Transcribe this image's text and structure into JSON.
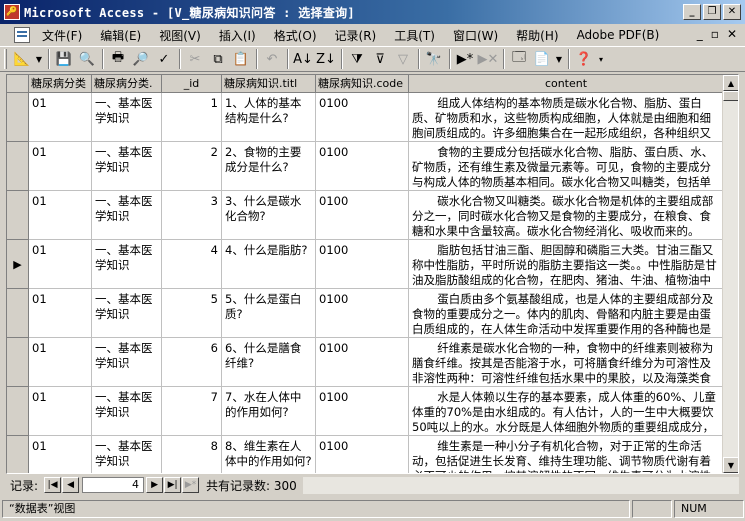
{
  "window": {
    "title": "Microsoft Access - [V_糖尿病知识问答 : 选择查询]",
    "min_icon": "minimize-icon",
    "max_icon": "restore-icon",
    "close_icon": "close-icon"
  },
  "menu": {
    "items": [
      "文件(F)",
      "编辑(E)",
      "视图(V)",
      "插入(I)",
      "格式(O)",
      "记录(R)",
      "工具(T)",
      "窗口(W)",
      "帮助(H)",
      "Adobe PDF(B)"
    ],
    "doc_controls": [
      "_",
      "▫",
      "✕"
    ]
  },
  "toolbar": {
    "icons": [
      "design-view-icon",
      "dropdown-arrow-icon",
      "save-icon",
      "file-search-icon",
      "print-icon",
      "print-preview-icon",
      "spelling-icon",
      "cut-icon",
      "copy-icon",
      "paste-icon",
      "undo-icon",
      "sort-ascending-icon",
      "sort-descending-icon",
      "filter-by-selection-icon",
      "filter-by-form-icon",
      "apply-filter-icon",
      "find-icon",
      "new-record-icon",
      "delete-record-icon",
      "database-window-icon",
      "new-object-icon",
      "help-icon"
    ]
  },
  "grid": {
    "columns": [
      {
        "key": "c1",
        "header": "糖尿病分类"
      },
      {
        "key": "c2",
        "header": "糖尿病分类."
      },
      {
        "key": "c3",
        "header": "_id"
      },
      {
        "key": "c4",
        "header": "糖尿病知识.titl"
      },
      {
        "key": "c5",
        "header": "糖尿病知识.code"
      },
      {
        "key": "c6",
        "header": "content"
      }
    ],
    "current_row_marker": "▶",
    "rows": [
      {
        "c1": "01",
        "c2": "一、基本医学知识",
        "c3": "1",
        "c4": "1、人体的基本结构是什么?",
        "c5": "0100",
        "c6": "组成人体结构的基本物质是碳水化合物、脂肪、蛋白质、矿物质和水，这些物质构成细胞，人体就是由细胞和细胞间质组成的。许多细胞集合在一起形成组织，各种组织又构成了器官。"
      },
      {
        "c1": "01",
        "c2": "一、基本医学知识",
        "c3": "2",
        "c4": "2、食物的主要成分是什么?",
        "c5": "0100",
        "c6": "食物的主要成分包括碳水化合物、脂肪、蛋白质、水、矿物质，还有维生素及微量元素等。可见，食物的主要成分与构成人体的物质基本相同。碳水化合物又叫糖类，包括单糖、双糖和多糖。"
      },
      {
        "c1": "01",
        "c2": "一、基本医学知识",
        "c3": "3",
        "c4": "3、什么是碳水化合物?",
        "c5": "0100",
        "c6": "碳水化合物又叫糖类。碳水化合物是机体的主要组成部分之一，同时碳水化合物又是食物的主要成分，在粮食、食糖和水果中含量较高。碳水化合物经消化、吸收而来的。"
      },
      {
        "c1": "01",
        "c2": "一、基本医学知识",
        "c3": "4",
        "c4": "4、什么是脂肪?",
        "c5": "0100",
        "c6": "脂肪包括甘油三酯、胆固醇和磷脂三大类。甘油三酯又称中性脂肪，平时所说的脂肪主要指这一类。。中性脂肪是甘油及脂肪酸组成的化合物，在肥肉、猪油、牛油、植物油中含量丰富。"
      },
      {
        "c1": "01",
        "c2": "一、基本医学知识",
        "c3": "5",
        "c4": "5、什么是蛋白质?",
        "c5": "0100",
        "c6": "蛋白质由多个氨基酸组成，也是人体的主要组成部分及食物的重要成分之一。体内的肌肉、骨骼和内脏主要是由蛋白质组成的，在人体生命活动中发挥重要作用的各种酶也是蛋白质。"
      },
      {
        "c1": "01",
        "c2": "一、基本医学知识",
        "c3": "6",
        "c4": "6、什么是膳食纤维?",
        "c5": "0100",
        "c6": "纤维素是碳水化合物的一种，食物中的纤维素则被称为膳食纤维。按其是否能溶于水，可将膳食纤维分为可溶性及非溶性两种：可溶性纤维包括水果中的果胶，以及海藻类食物中所含的藻胶等。"
      },
      {
        "c1": "01",
        "c2": "一、基本医学知识",
        "c3": "7",
        "c4": "7、水在人体中的作用如何?",
        "c5": "0100",
        "c6": "水是人体赖以生存的基本要素，成人体重的60%、儿童体重的70%是由水组成的。有人估计，人的一生中大概要饮50吨以上的水。水分既是人体细胞外物质的重要组成成分，又是人体内多种化学反应的媒介。"
      },
      {
        "c1": "01",
        "c2": "一、基本医学知识",
        "c3": "8",
        "c4": "8、维生素在人体中的作用如何?",
        "c5": "0100",
        "c6": "维生素是一种小分子有机化合物，对于正常的生命活动，包括促进生长发育、维持生理功能、调节物质代谢有着必不可少的作用。按其溶解性的不同，维生素可分为水溶性和脂溶性两类。"
      }
    ]
  },
  "navigation": {
    "label": "记录:",
    "current": "4",
    "total_label": "共有记录数: 300"
  },
  "status": {
    "view": "“数据表”视图",
    "num": "NUM"
  }
}
